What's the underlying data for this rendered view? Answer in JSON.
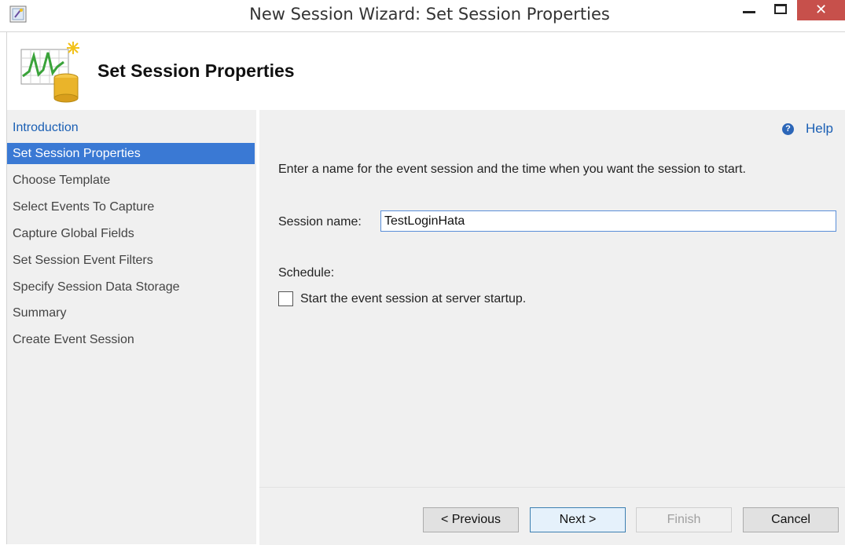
{
  "window": {
    "title": "New Session Wizard: Set Session Properties",
    "close_label": "✕"
  },
  "header": {
    "title": "Set Session Properties"
  },
  "nav": {
    "items": [
      {
        "label": "Introduction"
      },
      {
        "label": "Set Session Properties"
      },
      {
        "label": "Choose Template"
      },
      {
        "label": "Select Events To Capture"
      },
      {
        "label": "Capture Global Fields"
      },
      {
        "label": "Set Session Event Filters"
      },
      {
        "label": "Specify Session Data Storage"
      },
      {
        "label": "Summary"
      },
      {
        "label": "Create Event Session"
      }
    ],
    "active_index": 1
  },
  "content": {
    "help_label": "Help",
    "help_icon_glyph": "?",
    "intro": "Enter a name for the event session and the time when you want the session to start.",
    "session_name_label": "Session name:",
    "session_name_value": "TestLoginHata",
    "schedule_label": "Schedule:",
    "startup_checkbox_label": "Start the event session at server startup.",
    "startup_checked": false
  },
  "footer": {
    "previous_label": "< Previous",
    "next_label": "Next >",
    "finish_label": "Finish",
    "cancel_label": "Cancel"
  },
  "colors": {
    "accent": "#3a79d4",
    "link": "#1a5fb4",
    "close_button": "#c7504b"
  }
}
